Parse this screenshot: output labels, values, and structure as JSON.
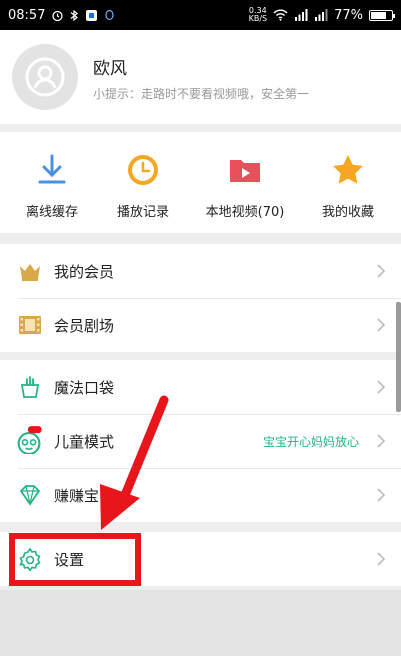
{
  "status_bar": {
    "time": "08:57",
    "net_speed_value": "0.34",
    "net_speed_unit": "KB/S",
    "battery_percent": "77%",
    "battery_level": 0.77
  },
  "profile": {
    "name": "欧风",
    "tip": "小提示：走路时不要看视频哦，安全第一"
  },
  "shortcuts": [
    {
      "label": "离线缓存",
      "icon": "download-icon"
    },
    {
      "label": "播放记录",
      "icon": "clock-icon"
    },
    {
      "label": "本地视频(70)",
      "icon": "folder-video-icon"
    },
    {
      "label": "我的收藏",
      "icon": "star-icon"
    }
  ],
  "menu": {
    "membership": "我的会员",
    "vip_theater": "会员剧场",
    "magic_pocket": "魔法口袋",
    "kids_mode": "儿童模式",
    "kids_mode_tagline": "宝宝开心妈妈放心",
    "earn": "赚赚宝",
    "settings": "设置"
  },
  "colors": {
    "accent_green": "#26b38a",
    "annotation_red": "#e8151b",
    "icon_blue": "#4a90e2",
    "icon_orange": "#f5a623",
    "icon_pink": "#e8505b"
  }
}
